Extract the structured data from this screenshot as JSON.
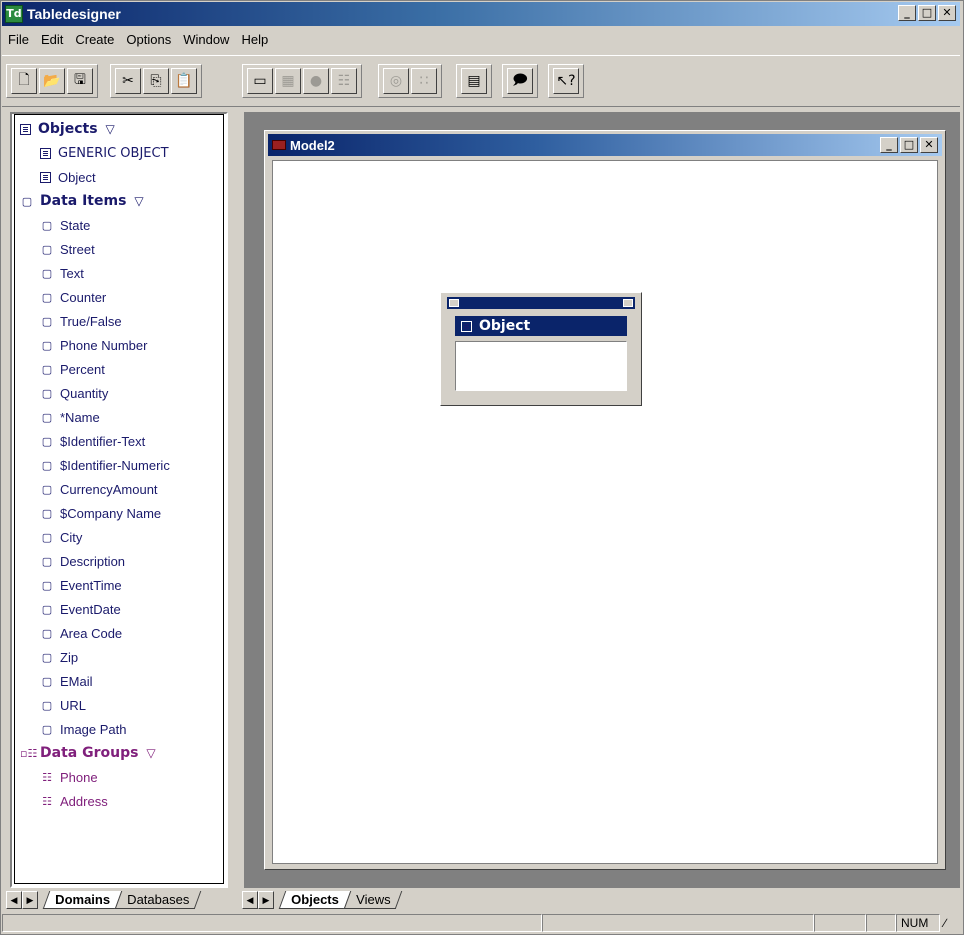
{
  "window": {
    "title": "Tabledesigner",
    "app_icon": "Td",
    "min": "_",
    "max": "□",
    "close": "✕"
  },
  "menu": [
    "File",
    "Edit",
    "Create",
    "Options",
    "Window",
    "Help"
  ],
  "toolbar": {
    "group1": [
      "new-icon",
      "open-icon",
      "save-icon"
    ],
    "group2": [
      "cut-icon",
      "copy-icon",
      "paste-icon"
    ],
    "group3": [
      "entity-icon",
      "table-icon",
      "database-icon",
      "hierarchy-icon"
    ],
    "group4": [
      "globe-icon",
      "layout-icon"
    ],
    "group5": [
      "properties-icon"
    ],
    "group6": [
      "comment-icon"
    ],
    "group7": [
      "help-icon"
    ]
  },
  "tree": {
    "objects_header": "Objects",
    "objects": [
      "GENERIC OBJECT",
      "Object"
    ],
    "data_items_header": "Data Items",
    "data_items": [
      "State",
      "Street",
      "Text",
      "Counter",
      "True/False",
      "Phone Number",
      "Percent",
      "Quantity",
      "*Name",
      "$Identifier-Text",
      "$Identifier-Numeric",
      "CurrencyAmount",
      "$Company Name",
      "City",
      "Description",
      "EventTime",
      "EventDate",
      "Area Code",
      "Zip",
      "EMail",
      "URL",
      "Image Path"
    ],
    "data_groups_header": "Data Groups",
    "data_groups": [
      "Phone",
      "Address"
    ]
  },
  "child_window": {
    "title": "Model2"
  },
  "entity": {
    "name": "Object"
  },
  "left_tabs": [
    "Domains",
    "Databases"
  ],
  "right_tabs": [
    "Objects",
    "Views"
  ],
  "status": {
    "num": "NUM"
  }
}
